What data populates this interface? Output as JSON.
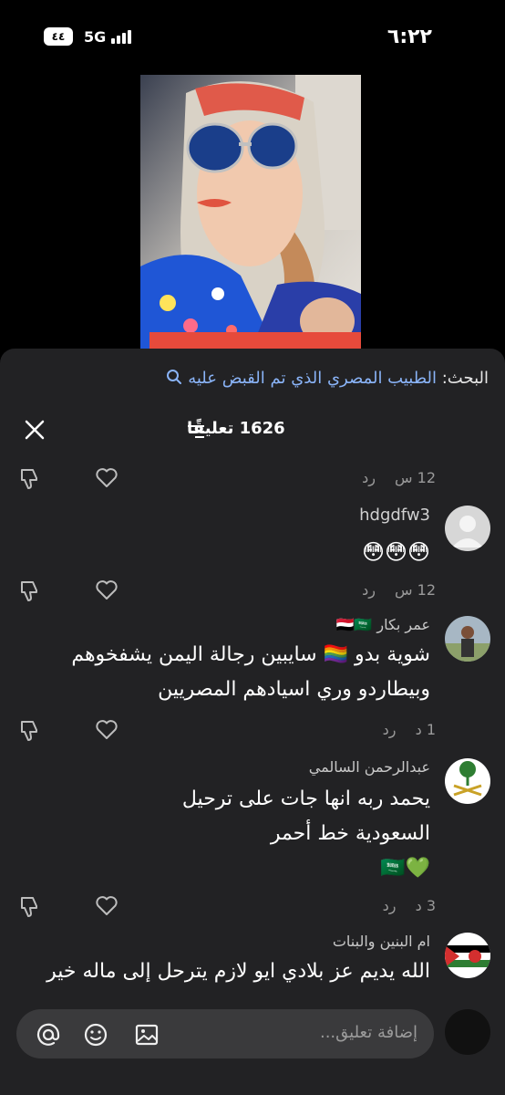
{
  "status_bar": {
    "time": "٦:٢٢",
    "battery": "٤٤",
    "network": "5G"
  },
  "video": {
    "banner_color": "#e64a3b"
  },
  "search": {
    "prefix": "البحث:",
    "query": "الطبيب المصري الذي تم القبض عليه"
  },
  "comments_header": {
    "count_label": "1626 تعليقًا"
  },
  "comments": [
    {
      "author": "",
      "text": "",
      "time": "12 س",
      "reply": "رد"
    },
    {
      "author": "hdgdfw3",
      "text": "😳😳😳",
      "time": "12 س",
      "reply": "رد"
    },
    {
      "author": "عمر بكار",
      "author_flags": "🇾🇪🇸🇦",
      "lines": [
        "شوية بدو 🏳️‍🌈 سايبين رجالة اليمن يشفخوهم",
        "وبيطاردو وري اسيادهم المصريين"
      ],
      "time": "1 د",
      "reply": "رد"
    },
    {
      "author": "عبدالرحمن السالمي",
      "lines": [
        "يحمد ربه انها جات على ترحيل",
        "السعودية خط أحمر",
        "💚🇸🇦"
      ],
      "time": "3 د",
      "reply": "رد"
    },
    {
      "author": "ام البنين والبنات",
      "lines": [
        "الله يديم عز بلادي ايو لازم يترحل إلى ماله خير"
      ]
    }
  ],
  "input": {
    "placeholder": "إضافة تعليق..."
  },
  "colors": {
    "sheet_bg": "#222224",
    "link_blue": "#8ab4f8",
    "muted": "#9a9a9a"
  }
}
